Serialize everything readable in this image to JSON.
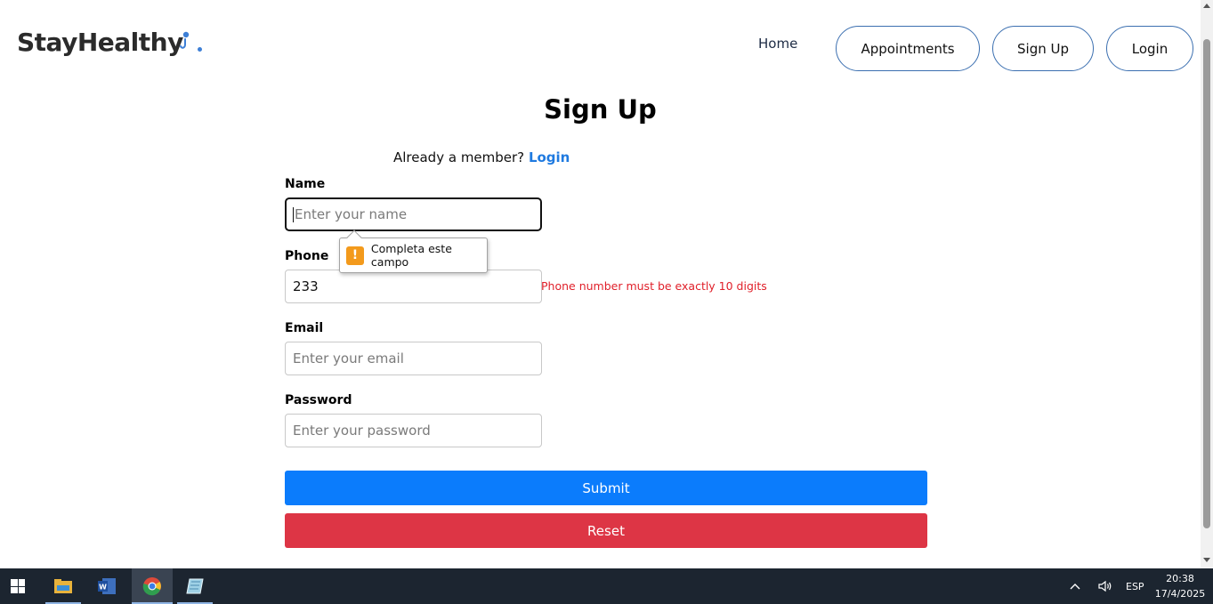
{
  "navbar": {
    "brand": "StayHealthy",
    "home": "Home",
    "appointments": "Appointments",
    "signup": "Sign Up",
    "login": "Login"
  },
  "form": {
    "title": "Sign Up",
    "already_member": "Already a member?",
    "login_link": "Login",
    "name_label": "Name",
    "name_placeholder": "Enter your name",
    "phone_label": "Phone",
    "phone_value": "233",
    "phone_error": "Phone number must be exactly 10 digits",
    "email_label": "Email",
    "email_placeholder": "Enter your email",
    "password_label": "Password",
    "password_placeholder": "Enter your password",
    "submit": "Submit",
    "reset": "Reset"
  },
  "tooltip": {
    "icon": "!",
    "text": "Completa este campo"
  },
  "taskbar": {
    "language": "ESP",
    "time": "20:38",
    "date": "17/4/2025"
  },
  "colors": {
    "primary": "#0b7cfc",
    "danger": "#dd3545",
    "error_text": "#e0202a",
    "link": "#1f7ae0"
  }
}
